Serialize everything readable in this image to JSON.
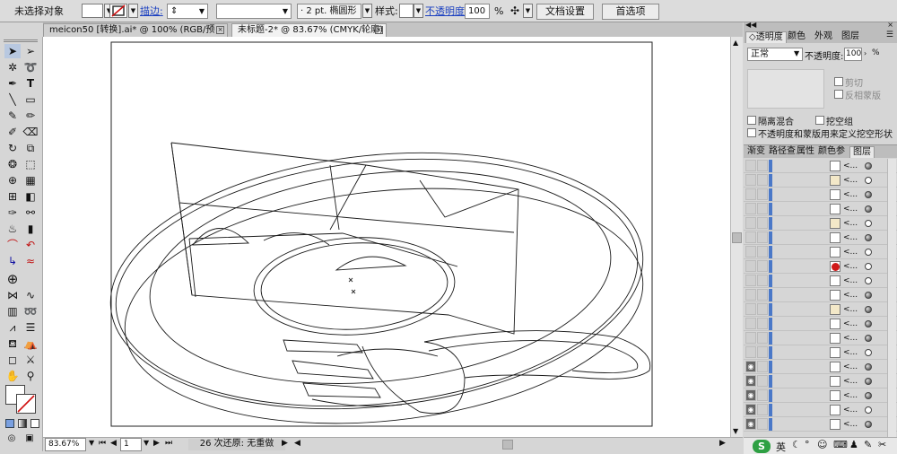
{
  "control_bar": {
    "selection_status": "未选择对象",
    "stroke_label": "描边:",
    "brush_value": "2 pt. 椭圆形",
    "style_label": "样式:",
    "opacity_label": "不透明度:",
    "opacity_value": "100",
    "opacity_unit": "%",
    "doc_setup_button": "文档设置",
    "preferences_button": "首选项"
  },
  "tabs": [
    {
      "label": "meicon50 [转换].ai* @ 100% (RGB/预览)",
      "close": "×"
    },
    {
      "label": "未标题-2* @ 83.67% (CMYK/轮廓)",
      "close": "×"
    }
  ],
  "transparency_panel": {
    "tabs": [
      "透明度",
      "颜色",
      "外观",
      "图层"
    ],
    "blend_mode": "正常",
    "opacity_label": "不透明度:",
    "opacity_value": "100",
    "opacity_unit": "%",
    "clip_label": "剪切",
    "invert_mask_label": "反相蒙版",
    "isolate_blending_label": "隔离混合",
    "knockout_group_label": "挖空组",
    "opacity_mask_label": "不透明度和蒙版用来定义挖空形状"
  },
  "layers_panel": {
    "tabs": [
      "渐变",
      "路径查",
      "属性",
      "颜色参",
      "图层"
    ],
    "row_name": "<..."
  },
  "status_bar": {
    "zoom": "83.67%",
    "page": "1",
    "undo_status": "26 次还原: 无重做"
  },
  "taskbar": {
    "ime_label": "英"
  },
  "colors": {
    "accent_blue": "#4a78c8",
    "no_stroke_red": "#d01010",
    "layer_thumb_red": "#d01818"
  }
}
